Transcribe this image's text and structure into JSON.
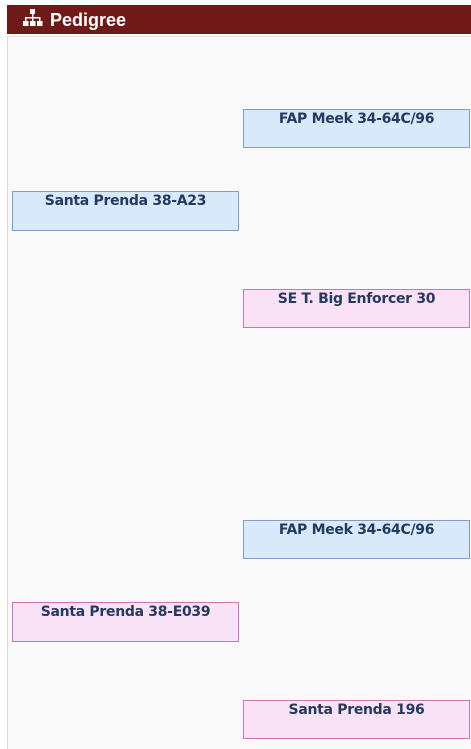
{
  "header": {
    "title": "Pedigree",
    "icon": "pedigree-tree-icon"
  },
  "colors": {
    "header_bg": "#701a18",
    "sire_bg": "#d8e9fa",
    "sire_border": "#7f9fc7",
    "dam_bg": "#fae2f6",
    "dam_border": "#c776b9",
    "text": "#243a5e"
  },
  "pedigree": {
    "sire": {
      "name": "Santa Prenda 38-A23",
      "sire": {
        "name": "FAP Meek 34-64C/96"
      },
      "dam": {
        "name": "SE T. Big Enforcer 30"
      }
    },
    "dam": {
      "name": "Santa Prenda 38-E039",
      "sire": {
        "name": "FAP Meek 34-64C/96"
      },
      "dam": {
        "name": "Santa Prenda 196"
      }
    }
  }
}
